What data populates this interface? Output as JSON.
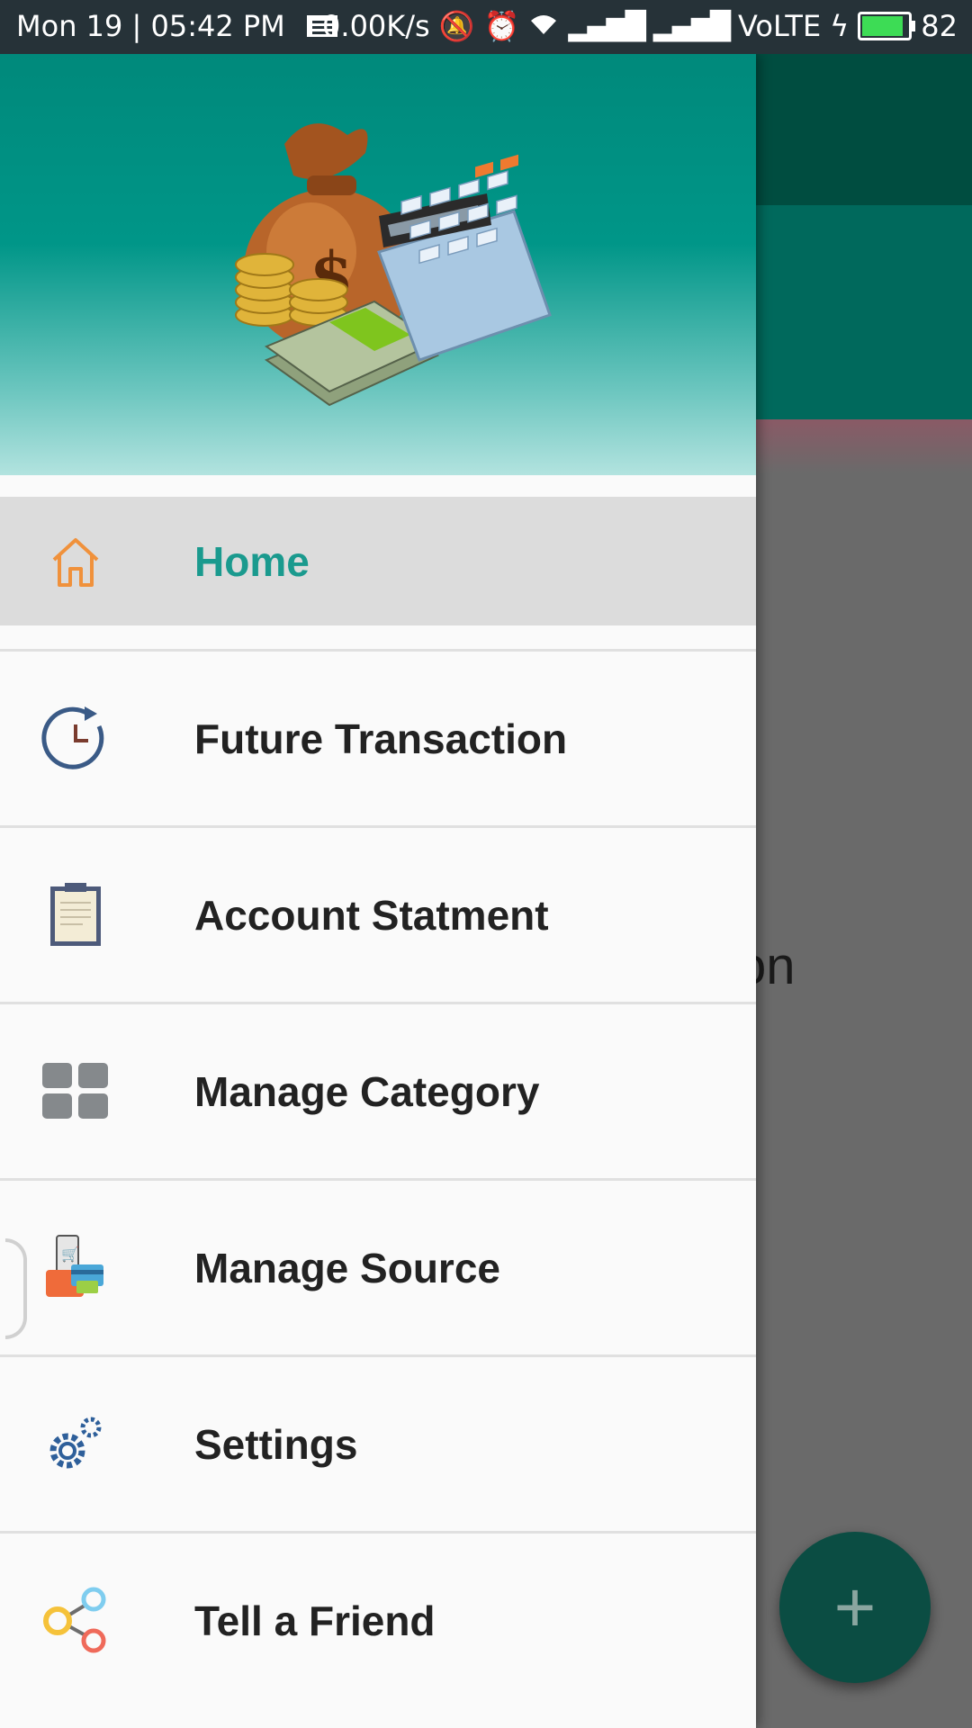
{
  "status_bar": {
    "time": "Mon 19 | 05:42 PM",
    "net_speed": "0.00K/s",
    "network": "VoLTE",
    "battery": "82",
    "battery_color": "#3ddc55"
  },
  "background": {
    "visible_text": "tion",
    "fab_label": "+"
  },
  "drawer": {
    "header_image": "money-bag-calculator-illustration",
    "items": [
      {
        "label": "Home",
        "icon": "home-icon",
        "active": true
      },
      {
        "label": "Future Transaction",
        "icon": "clock-refresh-icon",
        "active": false
      },
      {
        "label": "Account Statment",
        "icon": "clipboard-icon",
        "active": false
      },
      {
        "label": "Manage Category",
        "icon": "grid-icon",
        "active": false
      },
      {
        "label": "Manage Source",
        "icon": "wallet-cards-icon",
        "active": false
      },
      {
        "label": "Settings",
        "icon": "gears-icon",
        "active": false
      },
      {
        "label": "Tell a Friend",
        "icon": "share-icon",
        "active": false
      }
    ]
  },
  "colors": {
    "accent": "#1a9a8e",
    "header_top": "#00897b",
    "active_row": "#dcdcdc"
  }
}
